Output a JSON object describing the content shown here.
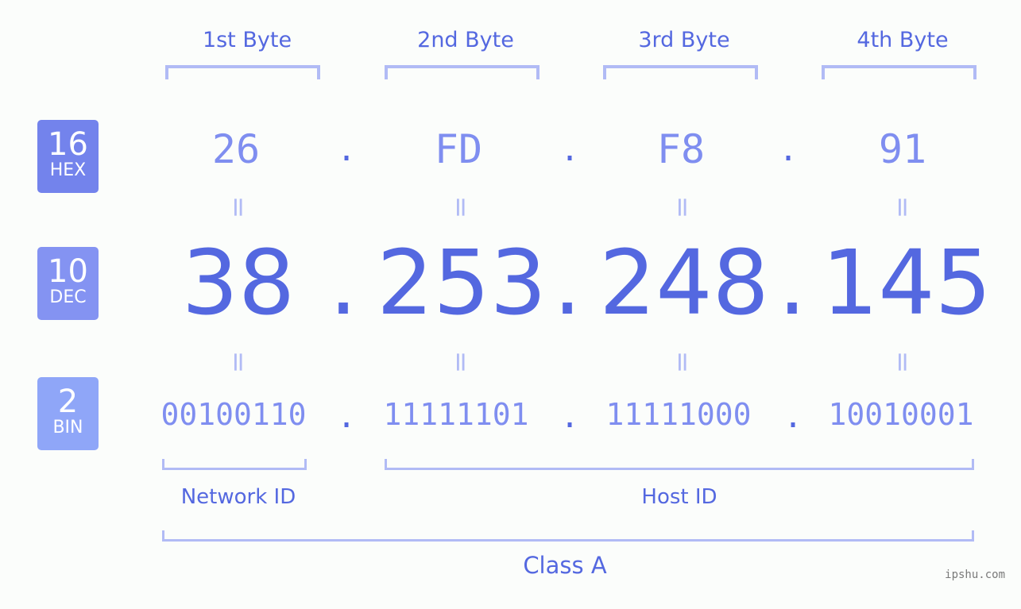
{
  "bytes": {
    "labels": [
      "1st Byte",
      "2nd Byte",
      "3rd Byte",
      "4th Byte"
    ]
  },
  "badges": {
    "hex": {
      "number": "16",
      "label": "HEX",
      "color": "#7383ec"
    },
    "dec": {
      "number": "10",
      "label": "DEC",
      "color": "#8493f2"
    },
    "bin": {
      "number": "2",
      "label": "BIN",
      "color": "#8fa6f8"
    }
  },
  "ip": {
    "hex": [
      "26",
      "FD",
      "F8",
      "91"
    ],
    "dec": [
      "38",
      "253",
      "248",
      "145"
    ],
    "bin": [
      "00100110",
      "11111101",
      "11111000",
      "10010001"
    ],
    "separator": ".",
    "equals": "="
  },
  "parts": {
    "network_id": "Network ID",
    "host_id": "Host ID",
    "class": "Class A"
  },
  "watermark": "ipshu.com",
  "colors": {
    "accent": "#5468e0",
    "light": "#7f8ef0",
    "bracket": "#b1bbf5"
  }
}
